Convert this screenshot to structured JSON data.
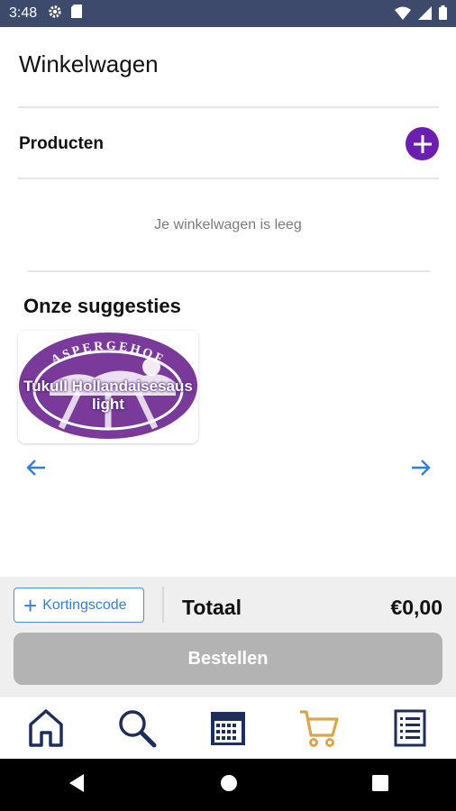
{
  "status_bar": {
    "time": "3:48"
  },
  "page": {
    "title": "Winkelwagen"
  },
  "products": {
    "label": "Producten",
    "empty_text": "Je winkelwagen is leeg"
  },
  "suggestions": {
    "title": "Onze suggesties",
    "items": [
      {
        "logo_text": "ASPERGEHOF",
        "name": "Tukull Hollandaisesaus light"
      }
    ]
  },
  "checkout": {
    "coupon_label": "Kortingscode",
    "total_label": "Totaal",
    "total_value": "€0,00",
    "order_label": "Bestellen"
  },
  "bottom_nav": {
    "items": [
      "home-icon",
      "search-icon",
      "calendar-icon",
      "cart-icon",
      "orders-list-icon"
    ],
    "active": "cart-icon"
  },
  "colors": {
    "status_bar": "#3d4a6b",
    "accent_purple": "#6a1fb0",
    "link_blue": "#2f7fe0",
    "nav_navy": "#1d2d5c",
    "cart_active": "#d9a64a",
    "disabled_button": "#b3b3b3"
  }
}
